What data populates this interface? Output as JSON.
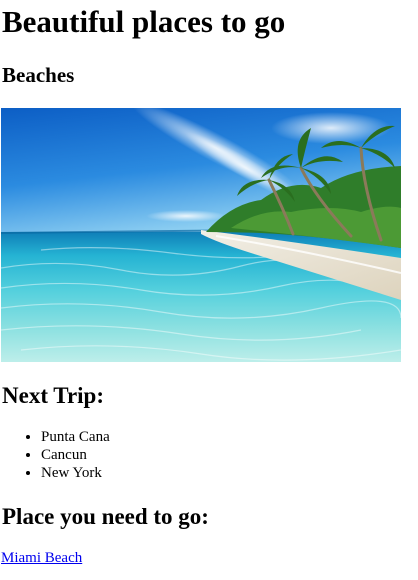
{
  "page": {
    "title": "Beautiful places to go",
    "section_heading": "Beaches"
  },
  "image": {
    "alt": "Tropical beach with turquoise water and palm trees"
  },
  "next_trip": {
    "heading": "Next Trip:",
    "items": [
      "Punta Cana",
      "Cancun",
      "New York"
    ]
  },
  "must_go": {
    "heading": "Place you need to go:",
    "link_label": "Miami Beach"
  },
  "colors": {
    "link": "#0000ee",
    "text": "#000000",
    "background": "#ffffff"
  }
}
